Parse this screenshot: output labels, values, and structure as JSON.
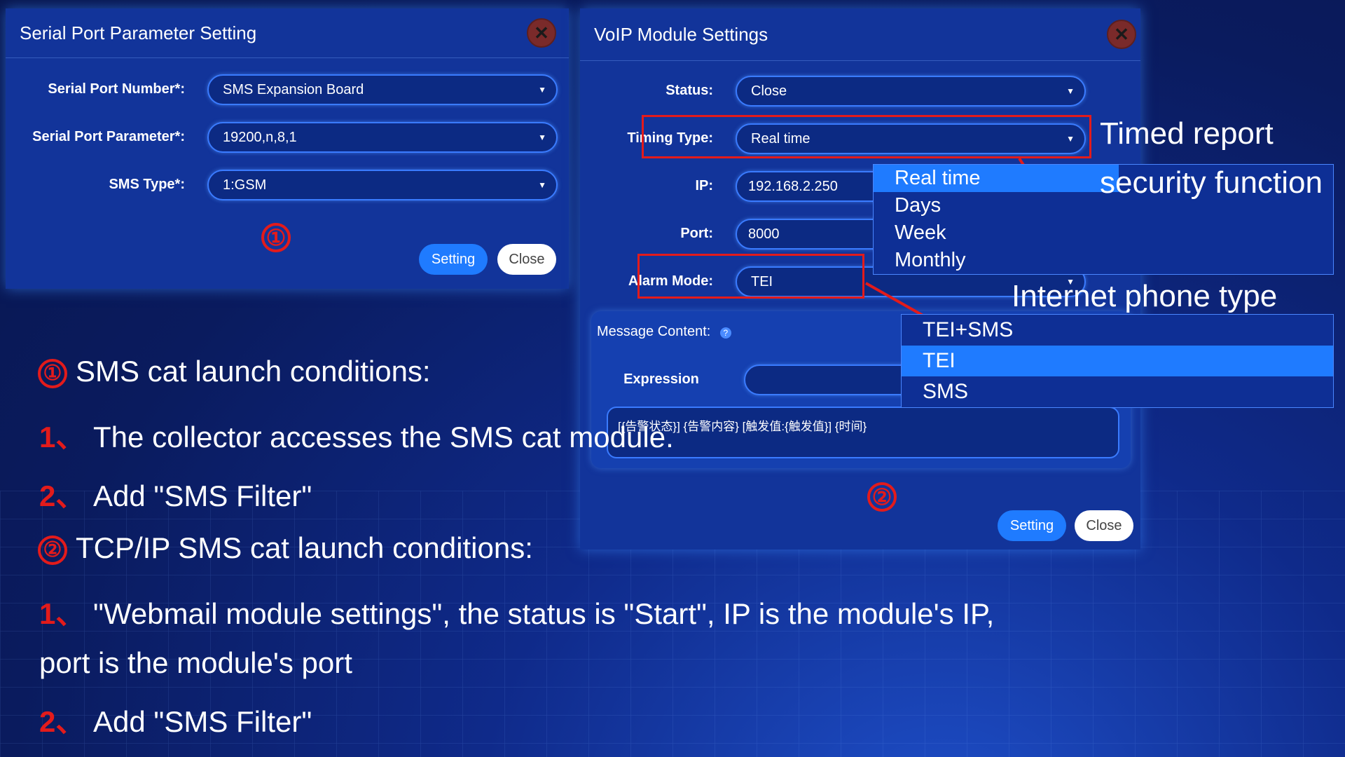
{
  "dialog1": {
    "title": "Serial Port Parameter Setting",
    "fields": [
      {
        "label": "Serial Port Number*:",
        "value": "SMS Expansion Board"
      },
      {
        "label": "Serial Port Parameter*:",
        "value": "19200,n,8,1"
      },
      {
        "label": "SMS Type*:",
        "value": "1:GSM"
      }
    ],
    "marker": "①",
    "setting_label": "Setting",
    "close_label": "Close"
  },
  "dialog2": {
    "title": "VoIP Module Settings",
    "fields": [
      {
        "label": "Status:",
        "value": "Close"
      },
      {
        "label": "Timing Type:",
        "value": "Real time"
      },
      {
        "label": "IP:",
        "value": "192.168.2.250"
      },
      {
        "label": "Port:",
        "value": "8000"
      },
      {
        "label": "Alarm Mode:",
        "value": "TEI"
      }
    ],
    "message_content_label": "Message Content:",
    "expression_label": "Expression",
    "message_text": "[{告警状态}] {告警内容} [触发值:{触发值}] {时间}",
    "marker": "②",
    "setting_label": "Setting",
    "close_label": "Close"
  },
  "timing_dropdown": {
    "items": [
      "Real time",
      "Days",
      "Week",
      "Monthly"
    ],
    "selected_index": 0
  },
  "alarm_dropdown": {
    "items": [
      "TEI+SMS",
      "TEI",
      "SMS"
    ],
    "selected_index": 1
  },
  "annotations": {
    "timed_report": "Timed report",
    "security_function": "security function",
    "internet_phone_type": "Internet phone type"
  },
  "notes": {
    "line1_marker": "①",
    "line1": "SMS cat launch conditions:",
    "line2_num": "1、",
    "line2": "The collector accesses the  SMS cat module.",
    "line3_num": "2、",
    "line3": "Add \"SMS Filter\"",
    "line4_marker": "②",
    "line4": "TCP/IP SMS cat launch conditions:",
    "line5_num": "1、",
    "line5": "\"Webmail module settings\", the status is \"Start\", IP is the module's IP,",
    "line6": "port is the module's port",
    "line7_num": "2、",
    "line7": "Add \"SMS Filter\""
  }
}
